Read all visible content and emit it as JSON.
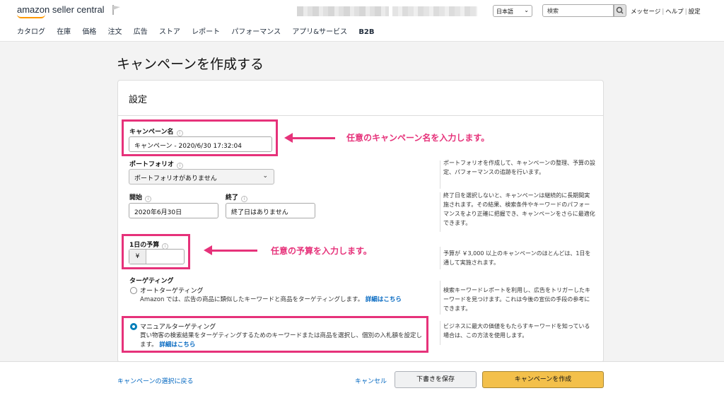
{
  "header": {
    "logo": "amazon seller central",
    "language": "日本語",
    "search_placeholder": "検索",
    "links": [
      "メッセージ",
      "ヘルプ",
      "設定"
    ]
  },
  "nav": [
    "カタログ",
    "在庫",
    "価格",
    "注文",
    "広告",
    "ストア",
    "レポート",
    "パフォーマンス",
    "アプリ&サービス",
    "B2B"
  ],
  "page_title": "キャンペーンを作成する",
  "settings": {
    "title": "設定",
    "campaign_name_label": "キャンペーン名",
    "campaign_name_value": "キャンペーン - 2020/6/30 17:32:04",
    "portfolio_label": "ポートフォリオ",
    "portfolio_value": "ポートフォリオがありません",
    "portfolio_help": "ポートフォリオを作成して、キャンペーンの整理、予算の設定、パフォーマンスの追跡を行います。",
    "start_label": "開始",
    "start_value": "2020年6月30日",
    "end_label": "終了",
    "end_value": "終了日はありません",
    "date_help": "終了日を選択しないと、キャンペーンは継続的に長期間実施されます。その結果、検索条件やキーワードのパフォーマンスをより正確に把握でき、キャンペーンをさらに最適化できます。",
    "budget_label": "1日の予算",
    "budget_currency": "¥",
    "budget_help": "予算が ￥3,000 以上のキャンペーンのほとんどは、1日を通して実施されます。",
    "targeting_label": "ターゲティング",
    "auto_label": "オートターゲティング",
    "auto_desc": "Amazon では、広告の商品に類似したキーワードと商品をターゲティングします。",
    "auto_link": "詳細はこちら",
    "auto_help": "検索キーワードレポートを利用し、広告をトリガーしたキーワードを見つけます。これは今後の宣伝の手段の参考にできます。",
    "manual_label": "マニュアルターゲティング",
    "manual_desc": "買い物客の検索結果をターゲティングするためのキーワードまたは商品を選択し、個別の入札額を設定します。",
    "manual_link": "詳細はこちら",
    "manual_help": "ビジネスに最大の価値をもたらすキーワードを知っている場合は、この方法を使用します。"
  },
  "annotations": {
    "name_note": "任意のキャンペーン名を入力します。",
    "budget_note": "任意の予算を入力します。"
  },
  "footer": {
    "back": "キャンペーンの選択に戻る",
    "cancel": "キャンセル",
    "save_draft": "下書きを保存",
    "create": "キャンペーンを作成"
  }
}
